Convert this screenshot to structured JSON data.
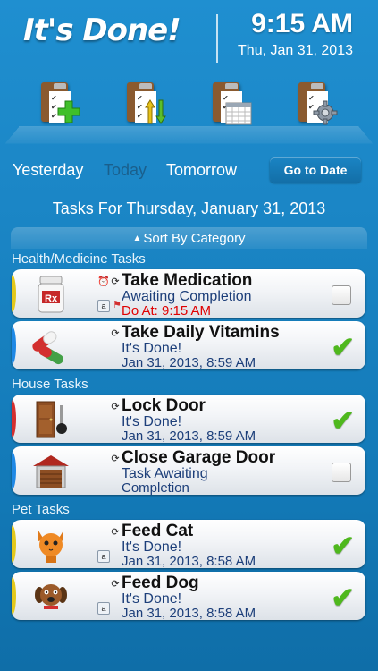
{
  "app": {
    "title": "It's Done!"
  },
  "status": {
    "time": "9:15 AM",
    "date": "Thu, Jan 31, 2013"
  },
  "toolbar": {
    "items": [
      {
        "name": "add-task",
        "icon": "clipboard-plus-icon"
      },
      {
        "name": "sort-tasks",
        "icon": "clipboard-arrows-icon"
      },
      {
        "name": "calendar",
        "icon": "clipboard-calendar-icon"
      },
      {
        "name": "settings",
        "icon": "clipboard-gear-icon"
      }
    ]
  },
  "days": {
    "yesterday": "Yesterday",
    "today": "Today",
    "tomorrow": "Tomorrow",
    "selected": "Today"
  },
  "go_to_date": "Go to Date",
  "heading": "Tasks For Thursday, January 31, 2013",
  "sort": {
    "label": "Sort By Category"
  },
  "sections": [
    {
      "title": "Health/Medicine Tasks",
      "tasks": [
        {
          "title": "Take Medication",
          "line2": "Awaiting Completion",
          "line3": "Do At: 9:15 AM",
          "line3_red": true,
          "done": false,
          "priority_color": "#e3c81a",
          "icon": "pill-bottle-icon",
          "icons": [
            "alarm-icon",
            "repeat-icon",
            "note-icon",
            "flag-icon"
          ]
        },
        {
          "title": "Take Daily Vitamins",
          "line2": "It's Done!",
          "line3": "Jan 31, 2013, 8:59 AM",
          "done": true,
          "priority_color": "#1e88e5",
          "icon": "capsules-icon",
          "icons": [
            "repeat-icon"
          ]
        }
      ]
    },
    {
      "title": "House Tasks",
      "tasks": [
        {
          "title": "Lock Door",
          "line2": "It's Done!",
          "line3": "Jan 31, 2013, 8:59 AM",
          "done": true,
          "priority_color": "#d32f2f",
          "icon": "door-key-icon",
          "icons": [
            "repeat-icon"
          ]
        },
        {
          "title": "Close Garage Door",
          "line2": "Task Awaiting",
          "line3": "Completion",
          "done": false,
          "priority_color": "#1e88e5",
          "icon": "garage-icon",
          "icons": [
            "repeat-icon"
          ]
        }
      ]
    },
    {
      "title": "Pet Tasks",
      "tasks": [
        {
          "title": "Feed Cat",
          "line2": "It's Done!",
          "line3": "Jan 31, 2013, 8:58 AM",
          "done": true,
          "priority_color": "#e3c81a",
          "icon": "cat-icon",
          "icons": [
            "repeat-icon",
            "note-icon"
          ]
        },
        {
          "title": "Feed Dog",
          "line2": "It's Done!",
          "line3": "Jan 31, 2013, 8:58 AM",
          "done": true,
          "priority_color": "#e3c81a",
          "icon": "dog-icon",
          "icons": [
            "repeat-icon",
            "note-icon"
          ]
        }
      ]
    }
  ]
}
